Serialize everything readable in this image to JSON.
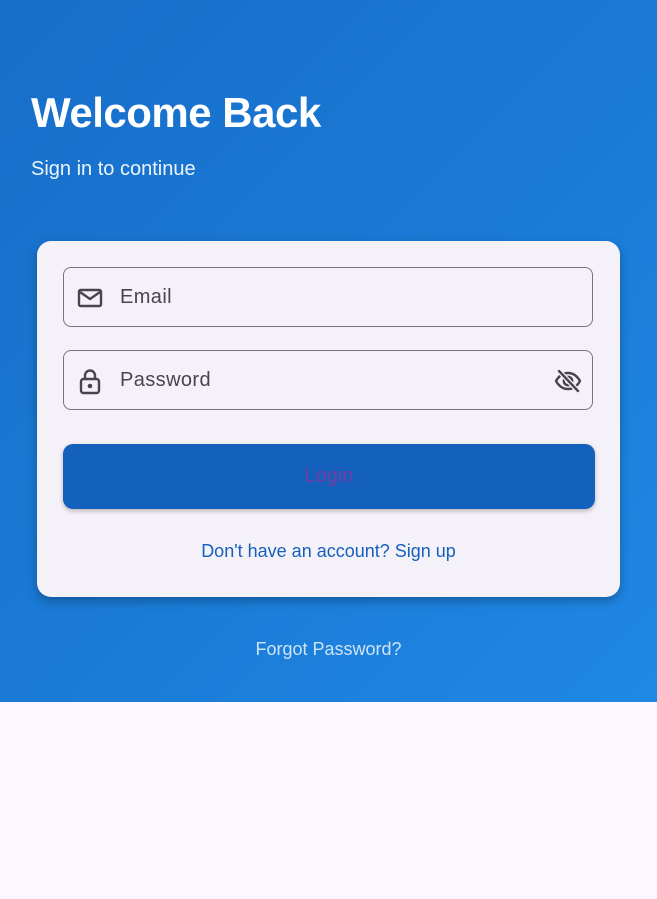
{
  "header": {
    "title": "Welcome Back",
    "subtitle": "Sign in to continue"
  },
  "form": {
    "email": {
      "value": "",
      "placeholder": "Email",
      "icon": "mail-icon"
    },
    "password": {
      "value": "",
      "placeholder": "Password",
      "icon": "lock-icon",
      "visibility_icon": "visibility-off-icon"
    },
    "login_label": "Login",
    "signup_prompt": "Don't have an account? Sign up"
  },
  "footer": {
    "forgot_password": "Forgot Password?"
  },
  "colors": {
    "primary": "#1460BD",
    "hero_start": "#176EC9",
    "hero_end": "#1F88E5",
    "surface": "#F5F1F8",
    "page_background": "#FDF7FF",
    "outline": "#78737F",
    "login_text": "#743CA5"
  }
}
